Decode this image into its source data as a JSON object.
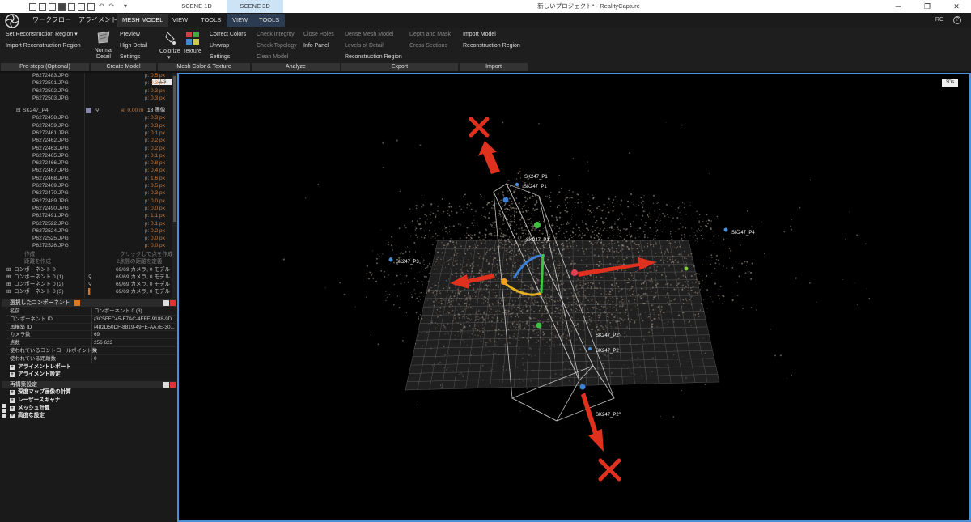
{
  "titlebar": {
    "scene_1d": "SCENE 1D",
    "scene_3d": "SCENE 3D",
    "title": "新しいプロジェクト* - RealityCapture"
  },
  "menubar": {
    "items": [
      "ワークフロー",
      "アライメント"
    ],
    "tabs": [
      "MESH MODEL",
      "VIEW",
      "TOOLS",
      "VIEW",
      "TOOLS"
    ],
    "rc": "RC",
    "help": "?"
  },
  "ribbon": {
    "prestep": {
      "set_region": "Set Reconstruction Region",
      "import_region": "Import Reconstruction Region",
      "label": "Pre-steps (Optional)"
    },
    "create": {
      "normal_detail": "Normal Detail",
      "preview": "Preview",
      "high_detail": "High Detail",
      "settings": "Settings",
      "label": "Create Model"
    },
    "color": {
      "colorize": "Colorize",
      "texture": "Texture",
      "correct_colors": "Correct Colors",
      "unwrap": "Unwrap",
      "settings": "Settings",
      "label": "Mesh Color & Texture"
    },
    "analyze": {
      "check_integrity": "Check Integrity",
      "check_topology": "Check Topology",
      "clean_model": "Clean Model",
      "close_holes": "Close Holes",
      "info_panel": "Info Panel",
      "label": "Analyze"
    },
    "export": {
      "dense_mesh": "Dense Mesh Model",
      "levels": "Levels of Detail",
      "recon_region": "Reconstruction Region",
      "depth_mask": "Depth and Mask",
      "cross_sections": "Cross Sections",
      "label": "Export"
    },
    "import": {
      "import_model": "Import Model",
      "recon_region": "Reconstruction Region",
      "label": "Import"
    }
  },
  "tree": {
    "badge": "1Ds",
    "rows": [
      {
        "name": "P6272483.JPG",
        "px": "p: 0.5 px"
      },
      {
        "name": "P6272501.JPG",
        "px": "p: 0.3 px"
      },
      {
        "name": "P6272502.JPG",
        "px": "p: 0.3 px"
      },
      {
        "name": "P6272503.JPG",
        "px": "p: 0.3 px"
      }
    ],
    "group": {
      "name": "SK247_P4",
      "err": "e: 0.00 m",
      "count": "18 画像"
    },
    "images": [
      {
        "name": "P6272458.JPG",
        "px": "p: 0.3 px"
      },
      {
        "name": "P6272459.JPG",
        "px": "p: 0.3 px"
      },
      {
        "name": "P6272461.JPG",
        "px": "p: 0.1 px"
      },
      {
        "name": "P6272462.JPG",
        "px": "p: 0.2 px"
      },
      {
        "name": "P6272463.JPG",
        "px": "p: 0.2 px"
      },
      {
        "name": "P6272465.JPG",
        "px": "p: 0.1 px"
      },
      {
        "name": "P6272466.JPG",
        "px": "p: 0.8 px"
      },
      {
        "name": "P6272467.JPG",
        "px": "p: 0.4 px"
      },
      {
        "name": "P6272468.JPG",
        "px": "p: 1.6 px"
      },
      {
        "name": "P6272469.JPG",
        "px": "p: 0.5 px"
      },
      {
        "name": "P6272470.JPG",
        "px": "p: 0.3 px"
      },
      {
        "name": "P6272489.JPG",
        "px": "p: 0.0 px"
      },
      {
        "name": "P6272490.JPG",
        "px": "p: 0.0 px"
      },
      {
        "name": "P6272491.JPG",
        "px": "p: 1.1 px"
      },
      {
        "name": "P6272522.JPG",
        "px": "p: 0.1 px"
      },
      {
        "name": "P6272524.JPG",
        "px": "p: 0.2 px"
      },
      {
        "name": "P6272525.JPG",
        "px": "p: 0.0 px"
      },
      {
        "name": "P6272526.JPG",
        "px": "p: 0.0 px"
      }
    ],
    "create_label": "作成",
    "create_hint": "クリックして点を作成",
    "distance_label": "距離を作成",
    "distance_hint": "2点間の距離を定義",
    "components": [
      {
        "name": "コンポーネント 0",
        "info": "69/69 カメラ, 0 モデル"
      },
      {
        "name": "コンポーネント 0 (1)",
        "info": "69/69 カメラ, 0 モデル"
      },
      {
        "name": "コンポーネント 0 (2)",
        "info": "69/69 カメラ, 0 モデル"
      },
      {
        "name": "コンポーネント 0 (3)",
        "info": "69/69 カメラ, 0 モデル"
      }
    ]
  },
  "selected": {
    "title": "選択したコンポーネント",
    "props": [
      {
        "k": "名前",
        "v": "コンポーネント 0 (3)"
      },
      {
        "k": "コンポーネント ID",
        "v": "{3C5FFC45-F7AC-4FFE-9188-9D..."
      },
      {
        "k": "再構築 ID",
        "v": "{482D50DF-8819-49FE-AA7E-30..."
      },
      {
        "k": "カメラ数",
        "v": "69"
      },
      {
        "k": "点数",
        "v": "256 623"
      },
      {
        "k": "使われているコントロールポイント数",
        "v": "4"
      },
      {
        "k": "使われている距離数",
        "v": "0"
      }
    ],
    "sections": [
      "アライメントレポート",
      "アライメント設定"
    ]
  },
  "recon": {
    "title": "再構築設定",
    "sections": [
      "深度マップ画像の計算",
      "レーザースキャナ",
      "メッシュ計算",
      "高度な設定"
    ]
  },
  "viewport": {
    "badge": "3Ds",
    "labels": [
      "SK247_P1",
      "SK247_P1",
      "SK247_P1'",
      "SK247_P3",
      "SK247_P4",
      "SK247_P2'",
      "SK247_P2",
      "SK247_P2''"
    ]
  },
  "colors": {
    "accent": "#4a90d9",
    "arrow": "#e0301e",
    "px_text": "#c8793a"
  }
}
